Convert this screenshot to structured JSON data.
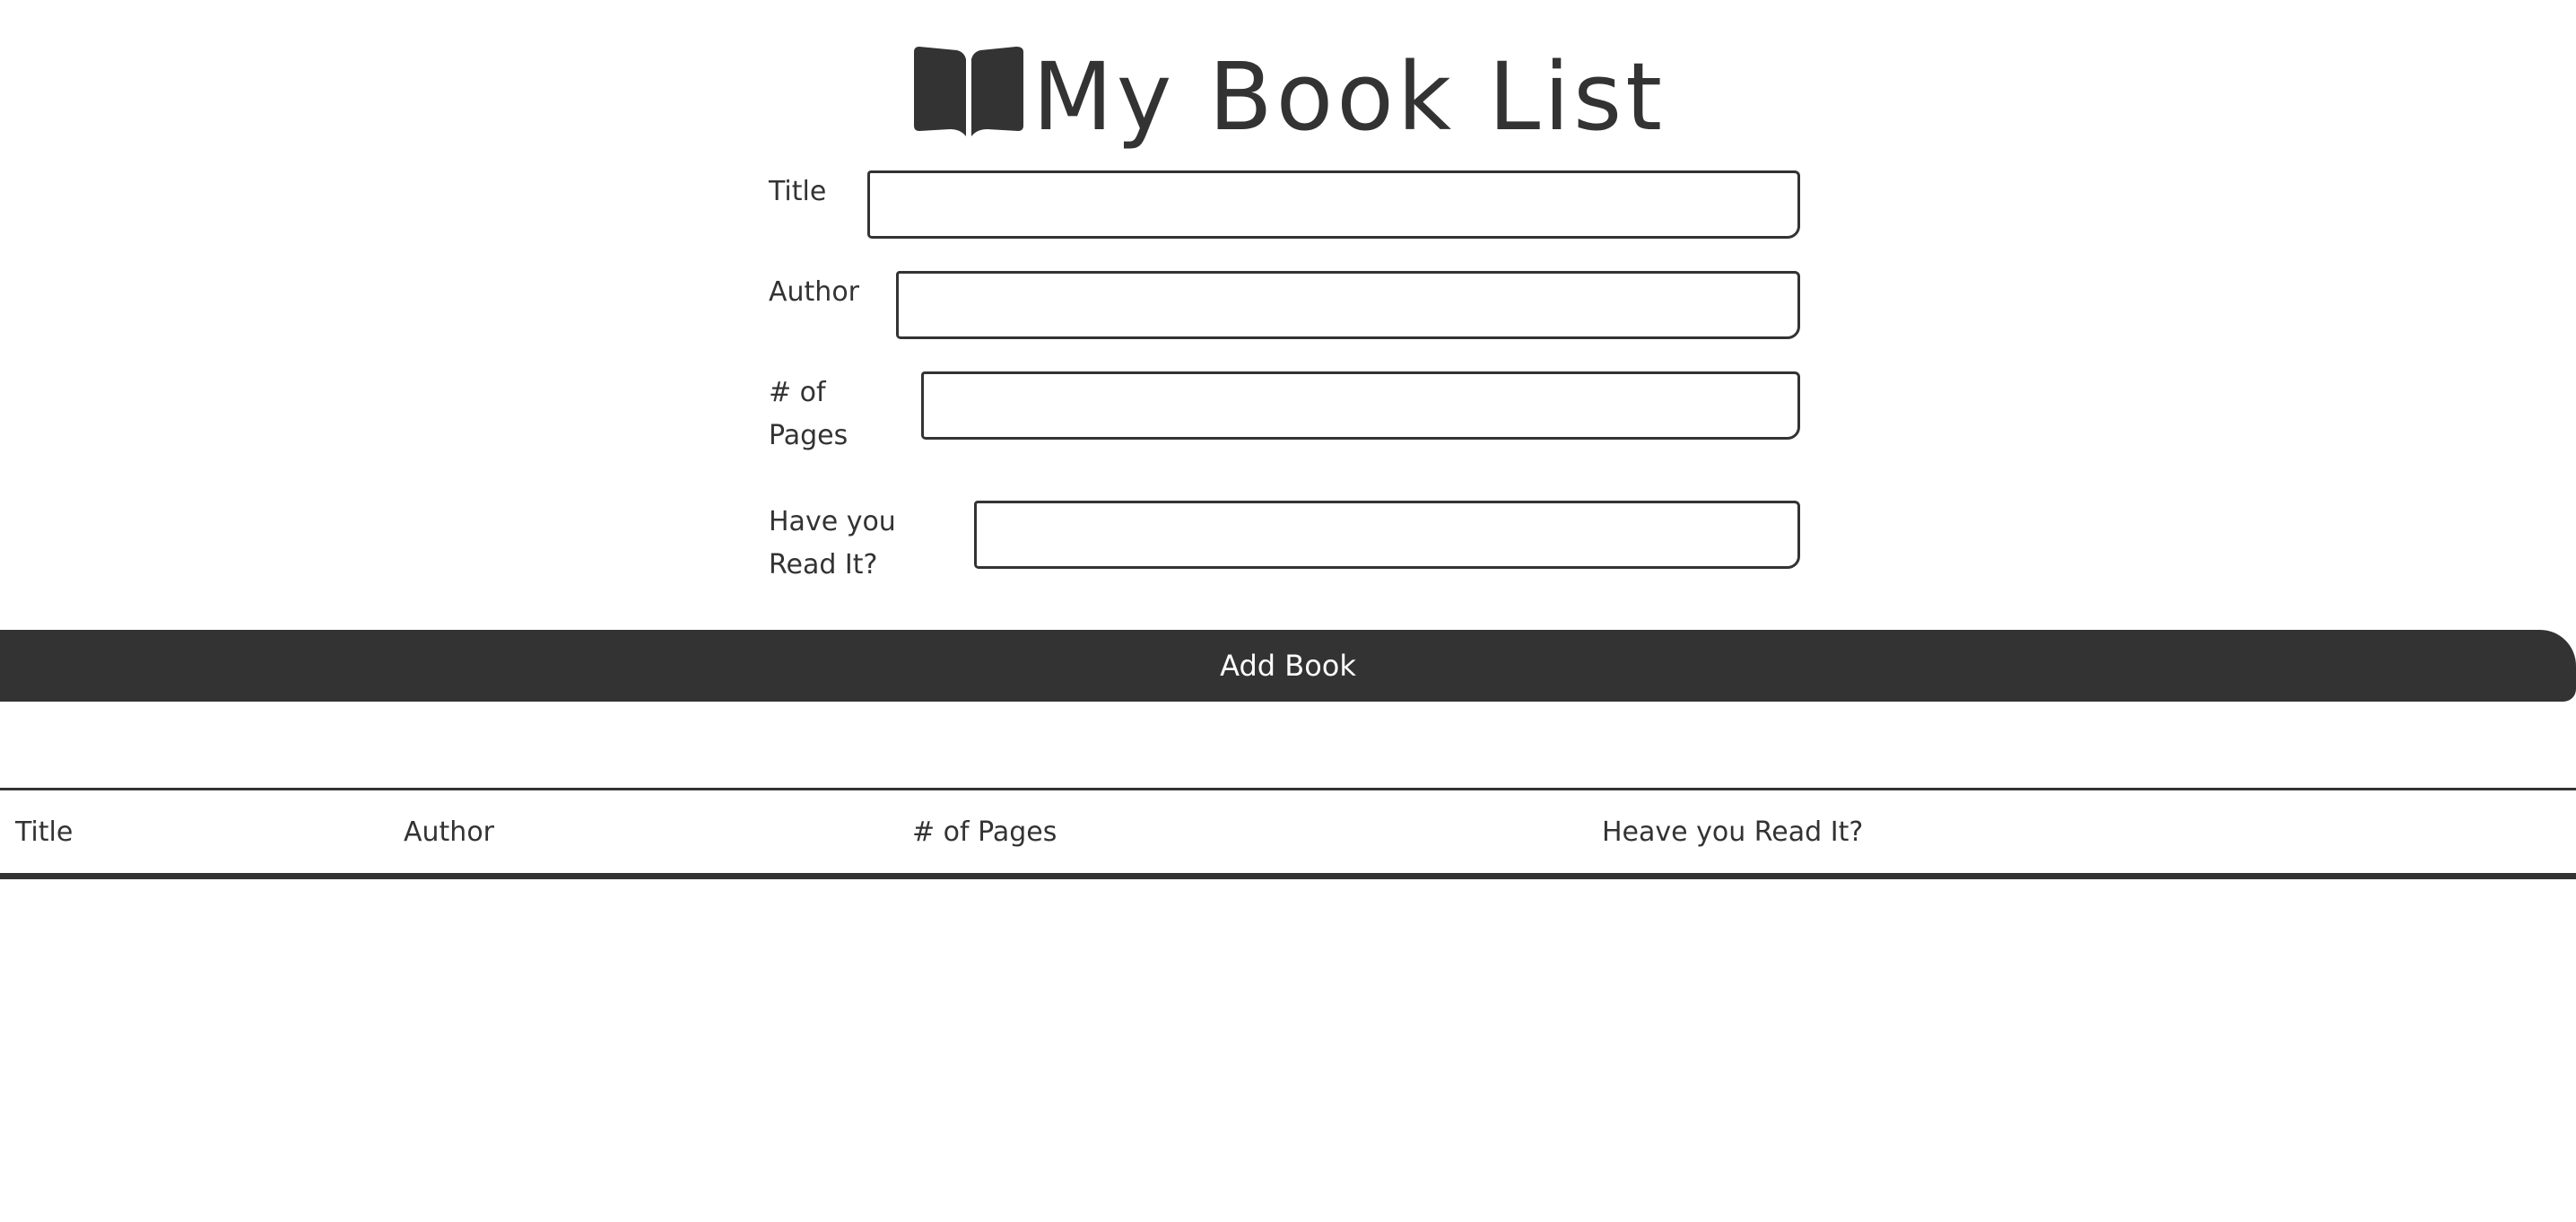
{
  "header": {
    "icon": "open-book-icon",
    "title": "My Book List"
  },
  "form": {
    "title_label": "Title",
    "title_value": "",
    "author_label": "Author",
    "author_value": "",
    "pages_label": "# of Pages",
    "pages_value": "",
    "read_label": "Have you Read It?",
    "read_value": ""
  },
  "add_button": {
    "label": "Add Book"
  },
  "table": {
    "columns": [
      "Title",
      "Author",
      "# of Pages",
      "Heave you Read It?"
    ],
    "rows": []
  },
  "colors": {
    "primary": "#333333",
    "background": "#ffffff",
    "button_text": "#ffffff"
  }
}
